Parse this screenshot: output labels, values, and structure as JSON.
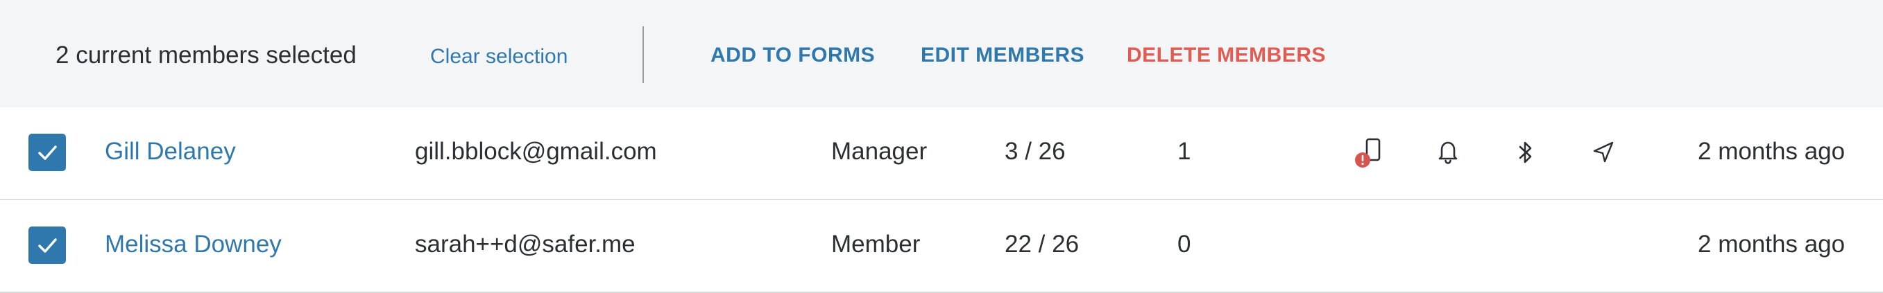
{
  "toolbar": {
    "selection_text": "2 current members selected",
    "clear_label": "Clear selection",
    "add_to_forms_label": "ADD TO FORMS",
    "edit_members_label": "EDIT MEMBERS",
    "delete_members_label": "DELETE MEMBERS"
  },
  "members": [
    {
      "selected": true,
      "name": "Gill Delaney",
      "email": "gill.bblock@gmail.com",
      "role": "Manager",
      "forms": "3 / 26",
      "count": "1",
      "icons": [
        "phone-warning-icon",
        "bell-icon",
        "bluetooth-icon",
        "location-arrow-icon"
      ],
      "last_active": "2 months ago"
    },
    {
      "selected": true,
      "name": "Melissa Downey",
      "email": "sarah++d@safer.me",
      "role": "Member",
      "forms": "22 / 26",
      "count": "0",
      "icons": [],
      "last_active": "2 months ago"
    }
  ],
  "colors": {
    "accent": "#2f78ad",
    "danger": "#e25b53",
    "toolbar_bg": "#f4f5f6",
    "text": "#2b2f33"
  }
}
